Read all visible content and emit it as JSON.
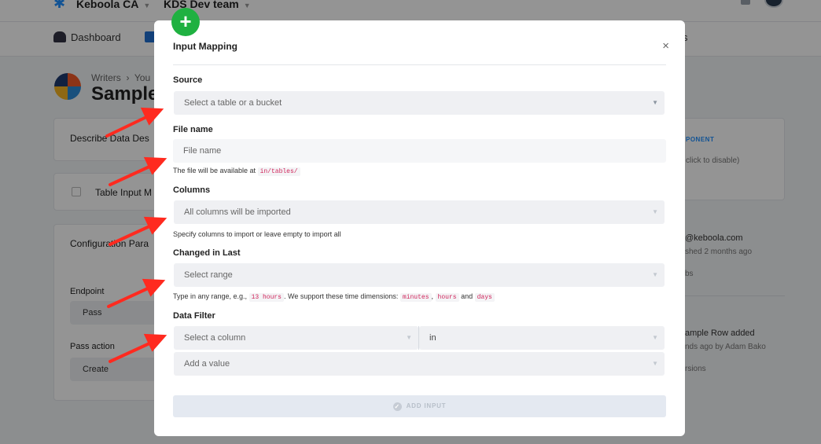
{
  "background": {
    "org_name": "Keboola CA",
    "project_name": "KDS Dev team",
    "nav_dashboard": "Dashboard",
    "nav_partial_right": "s",
    "breadcrumb_first": "Writers",
    "breadcrumb_second": "You",
    "page_title_partial": "Sample",
    "card_describe": "Describe Data Des",
    "card_table_input": "Table Input M",
    "card_config_params": "Configuration Para",
    "endpoint_label": "Endpoint",
    "endpoint_value": "Pass",
    "pass_action_label": "Pass action",
    "pass_action_value": "Create",
    "side_component_label": "PONENT",
    "side_disable_hint": "click to disable)",
    "side_email": "@keboola.com",
    "side_published": "shed 2 months ago",
    "side_bs": "bs",
    "side_row_added": "ample Row added",
    "side_row_meta": "nds ago by Adam Bako",
    "side_versions": "rsions"
  },
  "modal": {
    "title": "Input Mapping",
    "close_symbol": "×",
    "plus_symbol": "+",
    "source": {
      "label": "Source",
      "placeholder": "Select a table or a bucket"
    },
    "file_name": {
      "label": "File name",
      "placeholder": "File name",
      "help_prefix": "The file will be available at",
      "help_code": "in/tables/"
    },
    "columns": {
      "label": "Columns",
      "placeholder": "All columns will be imported",
      "help": "Specify columns to import or leave empty to import all"
    },
    "changed_in_last": {
      "label": "Changed in Last",
      "placeholder": "Select range",
      "help_prefix": "Type in any range, e.g.,",
      "help_example": "13 hours",
      "help_middle": ". We support these time dimensions:",
      "dim_minutes": "minutes",
      "dim_hours": "hours",
      "help_and": "and",
      "dim_days": "days"
    },
    "data_filter": {
      "label": "Data Filter",
      "column_placeholder": "Select a column",
      "operator_value": "in",
      "value_placeholder": "Add a value"
    },
    "add_input_label": "ADD INPUT",
    "add_input_check": "✓"
  },
  "colors": {
    "accent_green": "#1fb141",
    "annotation_red": "#ff2a1f",
    "code_red": "#d0255b"
  }
}
